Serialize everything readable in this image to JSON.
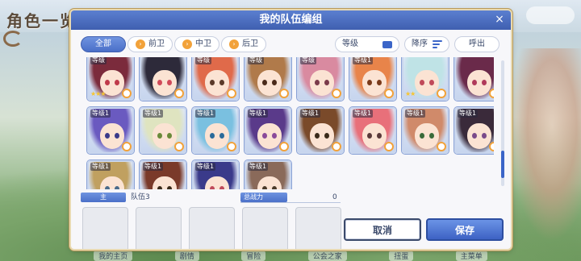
{
  "background": {
    "screen_title": "角色一览",
    "bottom_nav": [
      "我的主页",
      "剧情",
      "冒险",
      "公会之家",
      "扭蛋",
      "主菜单"
    ]
  },
  "modal": {
    "title": "我的队伍编组",
    "close_symbol": "×"
  },
  "filters": {
    "tabs": [
      {
        "label": "全部",
        "active": true,
        "icon": ""
      },
      {
        "label": "前卫",
        "active": false,
        "icon": "front-position-icon"
      },
      {
        "label": "中卫",
        "active": false,
        "icon": "middle-position-icon"
      },
      {
        "label": "后卫",
        "active": false,
        "icon": "back-position-icon"
      }
    ],
    "sort_key": "等级",
    "order": "降序",
    "recall": "呼出"
  },
  "characters": [
    {
      "level": "等级",
      "stars": "★★★",
      "hair": "#7b2b3c",
      "eye": "#c03a4a"
    },
    {
      "level": "",
      "stars": "",
      "hair": "#2d2a3a",
      "eye": "#d04a5a"
    },
    {
      "level": "等级",
      "stars": "",
      "hair": "#e06a4a",
      "eye": "#5a3a2a"
    },
    {
      "level": "等级",
      "stars": "",
      "hair": "#b07a4a",
      "eye": "#4a2a1a"
    },
    {
      "level": "等级",
      "stars": "",
      "hair": "#d98aa0",
      "eye": "#7a3a4a"
    },
    {
      "level": "等级1",
      "stars": "",
      "hair": "#e8844a",
      "eye": "#7a3a1a"
    },
    {
      "level": "",
      "stars": "★★",
      "hair": "#bfe3e6",
      "eye": "#c04a5a"
    },
    {
      "level": "",
      "stars": "",
      "hair": "#6a2a4a",
      "eye": "#b03a5a"
    },
    {
      "level": "等级1",
      "stars": "",
      "hair": "#6a5ac0",
      "eye": "#3a3a8a"
    },
    {
      "level": "等级1",
      "stars": "",
      "hair": "#dfe4c0",
      "eye": "#6a8a3a"
    },
    {
      "level": "等级1",
      "stars": "",
      "hair": "#7ac0e0",
      "eye": "#2a6a9a"
    },
    {
      "level": "等级1",
      "stars": "",
      "hair": "#5a3a8a",
      "eye": "#8a4a9a"
    },
    {
      "level": "等级1",
      "stars": "",
      "hair": "#7a4a2a",
      "eye": "#3a2a1a"
    },
    {
      "level": "等级1",
      "stars": "",
      "hair": "#e8707a",
      "eye": "#5a3a3a"
    },
    {
      "level": "等级1",
      "stars": "",
      "hair": "#d08a6a",
      "eye": "#3a6a3a"
    },
    {
      "level": "等级1",
      "stars": "",
      "hair": "#3a2a3a",
      "eye": "#7a4a8a"
    },
    {
      "level": "等级1",
      "stars": "",
      "hair": "#c0a060",
      "eye": "#4a6a8a"
    },
    {
      "level": "等级1",
      "stars": "",
      "hair": "#7a3a2a",
      "eye": "#3a2a1a"
    },
    {
      "level": "等级1",
      "stars": "",
      "hair": "#3a3a8a",
      "eye": "#c04a5a"
    },
    {
      "level": "等级1",
      "stars": "",
      "hair": "#8a6a5a",
      "eye": "#4a3a2a"
    }
  ],
  "party": {
    "label": "主",
    "name": "队伍3",
    "power_label": "总战力",
    "power_value": "0",
    "slots": 5
  },
  "buttons": {
    "cancel": "取消",
    "save": "保存"
  },
  "colors": {
    "header": "#4a6fc8",
    "accent": "#3b65c8",
    "frame_gold": "#b89a5a"
  }
}
